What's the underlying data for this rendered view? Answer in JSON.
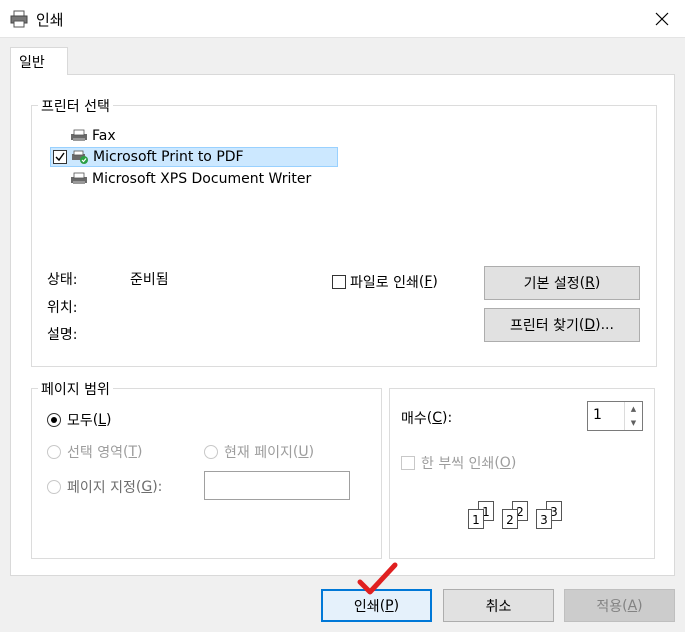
{
  "window": {
    "title": "인쇄",
    "close_icon": "close-icon",
    "title_icon": "printer-icon"
  },
  "tabs": [
    {
      "label": "일반"
    }
  ],
  "printer_select": {
    "group_label": "프린터 선택",
    "printers": [
      {
        "name": "Fax",
        "icon": "fax-printer-icon",
        "selected": false
      },
      {
        "name": "Microsoft Print to PDF",
        "icon": "pdf-printer-icon",
        "selected": true,
        "default": true
      },
      {
        "name": "Microsoft XPS Document Writer",
        "icon": "printer-icon",
        "selected": false
      }
    ],
    "status_label": "상태:",
    "status_value": "준비됨",
    "location_label": "위치:",
    "comment_label": "설명:",
    "print_to_file_label": "파일로 인쇄",
    "print_to_file_key": "F",
    "print_to_file_checked": false,
    "preferences_label": "기본 설정",
    "preferences_key": "R",
    "find_printer_label": "프린터 찾기",
    "find_printer_key": "D",
    "find_printer_suffix": "..."
  },
  "page_range": {
    "group_label": "페이지 범위",
    "all_label": "모두",
    "all_key": "L",
    "selection_label": "선택 영역",
    "selection_key": "T",
    "current_page_label": "현재 페이지",
    "current_page_key": "U",
    "pages_label": "페이지 지정",
    "pages_key": "G",
    "pages_suffix": ":",
    "pages_value": "",
    "selected": "all"
  },
  "copies": {
    "label": "매수",
    "key": "C",
    "suffix": ":",
    "value": "1",
    "collate_label": "한 부씩 인쇄",
    "collate_key": "O",
    "collate_checked": false,
    "collate_enabled": false,
    "collate_pages": [
      "1",
      "1",
      "2",
      "2",
      "3",
      "3"
    ]
  },
  "buttons": {
    "print_label": "인쇄",
    "print_key": "P",
    "cancel_label": "취소",
    "apply_label": "적용",
    "apply_key": "A"
  },
  "colors": {
    "accent": "#0078d7",
    "selection_bg": "#cce8ff",
    "checkmark_annotation": "#e02020",
    "default_badge": "#2c9f45"
  }
}
